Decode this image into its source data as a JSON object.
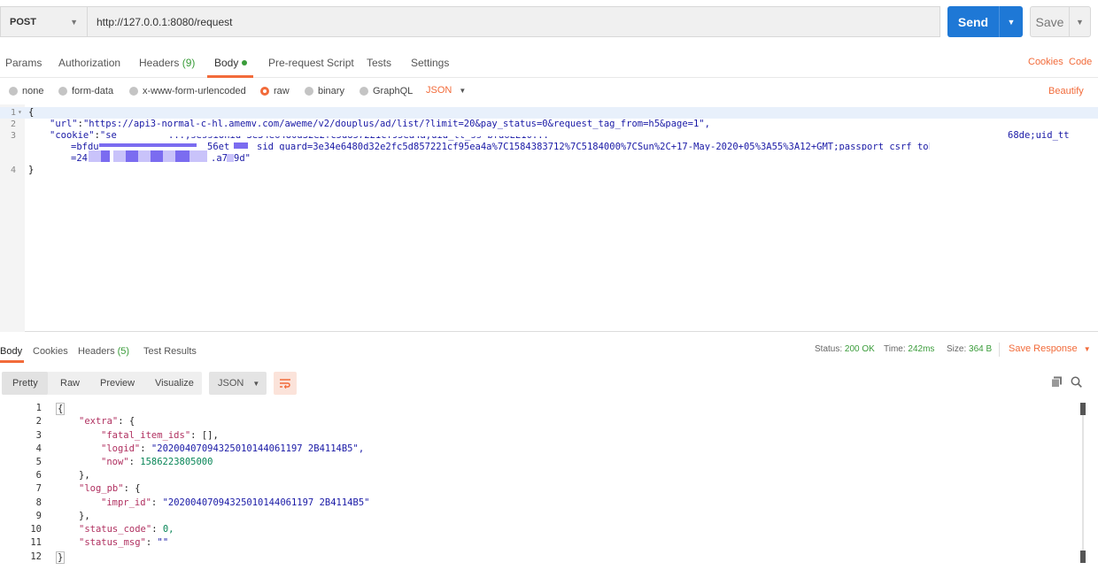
{
  "request": {
    "method": "POST",
    "url": "http://127.0.0.1:8080/request",
    "send_label": "Send",
    "save_label": "Save"
  },
  "req_tabs": {
    "params": "Params",
    "authorization": "Authorization",
    "headers": "Headers",
    "headers_count": "(9)",
    "body": "Body",
    "pre_request": "Pre-request Script",
    "tests": "Tests",
    "settings": "Settings",
    "cookies": "Cookies",
    "code": "Code"
  },
  "body_types": {
    "none": "none",
    "form_data": "form-data",
    "urlencoded": "x-www-form-urlencoded",
    "raw": "raw",
    "binary": "binary",
    "graphql": "GraphQL",
    "format": "JSON",
    "beautify": "Beautify"
  },
  "request_body": {
    "line_numbers": [
      "1",
      "2",
      "3",
      "4"
    ],
    "open_brace": "{",
    "url_key": "\"url\"",
    "url_value": "\"https://api3-normal-c-hl.amemv.com/aweme/v2/douplus/ad/list/?limit=20&pay_status=0&request_tag_from=h5&page=1\",",
    "cookie_key": "\"cookie\"",
    "cookie_start": "\"se",
    "cookie_part_a": "...;sessionid=3e34e6480d32e2fc5d857221cf95ea4a;uid_tt_ss=bfd6EE10...",
    "cookie_end": "68de;uid_tt",
    "cookie_line2_start": "=bfdu",
    "cookie_line2_mid": "56et",
    "cookie_line2_rest": "sid_guard=3e34e6480d32e2fc5d857221cf95ea4a%7C1584383712%7C5184000%7CSun%2C+17-May-2020+05%3A55%3A12+GMT;passport_csrf_token",
    "cookie_line3_start": "=24s",
    "cookie_line3_mid": ".a7",
    "cookie_line3_end": "9d\"",
    "close_brace": "}"
  },
  "resp_tabs": {
    "body": "Body",
    "cookies": "Cookies",
    "headers": "Headers",
    "headers_count": "(5)",
    "test_results": "Test Results",
    "status_label": "Status:",
    "status_value": "200 OK",
    "time_label": "Time:",
    "time_value": "242ms",
    "size_label": "Size:",
    "size_value": "364 B",
    "save_response": "Save Response"
  },
  "resp_toolbar": {
    "pretty": "Pretty",
    "raw": "Raw",
    "preview": "Preview",
    "visualize": "Visualize",
    "format": "JSON"
  },
  "response_body": {
    "line_numbers": [
      "1",
      "2",
      "3",
      "4",
      "5",
      "6",
      "7",
      "8",
      "9",
      "10",
      "11",
      "12"
    ],
    "l1": "{",
    "extra_key": "\"extra\"",
    "fatal_key": "\"fatal_item_ids\"",
    "fatal_val": "[],",
    "logid_key": "\"logid\"",
    "logid_val": "\"20200407094325010144061197 2B4114B5\",",
    "now_key": "\"now\"",
    "now_val": "1586223805000",
    "close_extra": "},",
    "logpb_key": "\"log_pb\"",
    "impr_key": "\"impr_id\"",
    "impr_val": "\"20200407094325010144061197 2B4114B5\"",
    "close_logpb": "},",
    "status_code_key": "\"status_code\"",
    "status_code_val": "0,",
    "status_msg_key": "\"status_msg\"",
    "status_msg_val": "\"\"",
    "l12": "}"
  },
  "colors": {
    "accent": "#f26b3a",
    "send": "#1e78d6",
    "success": "#3a9c3a"
  }
}
